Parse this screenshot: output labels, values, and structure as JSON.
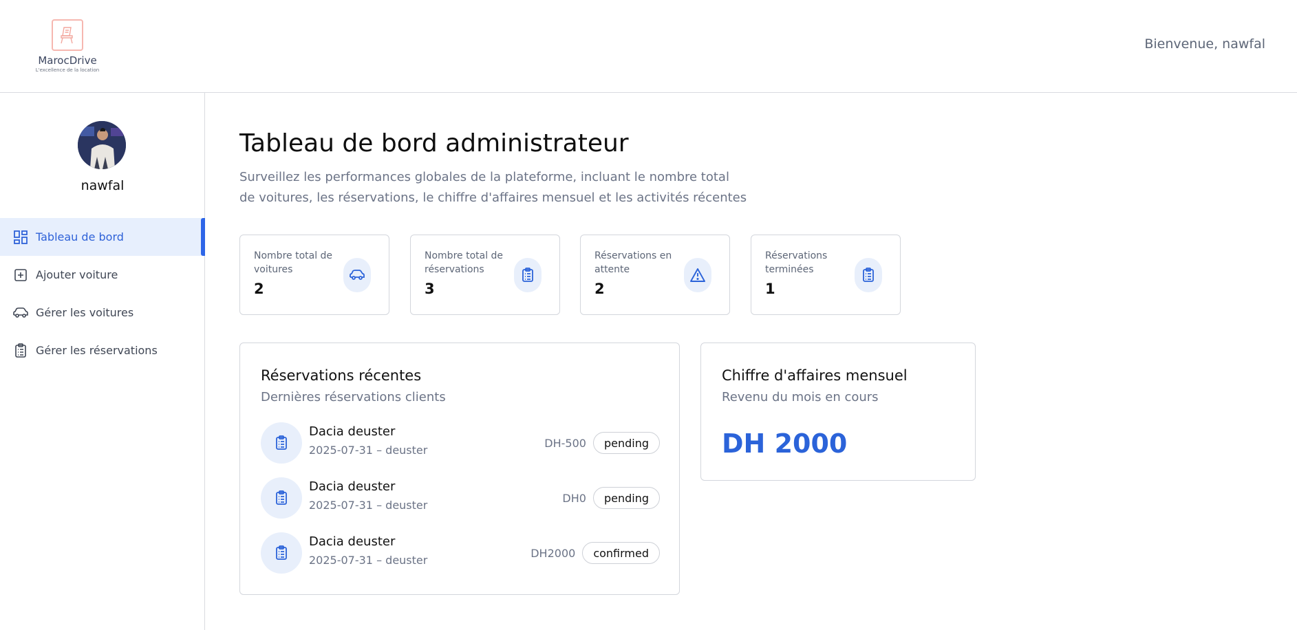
{
  "brand": {
    "name": "MarocDrive",
    "tagline": "L'excellence de la location"
  },
  "header": {
    "welcome": "Bienvenue, nawfal"
  },
  "sidebar": {
    "user_name": "nawfal",
    "items": [
      {
        "label": "Tableau de bord",
        "icon": "dashboard-icon",
        "active": true
      },
      {
        "label": "Ajouter voiture",
        "icon": "plus-square-icon",
        "active": false
      },
      {
        "label": "Gérer les voitures",
        "icon": "car-icon",
        "active": false
      },
      {
        "label": "Gérer les réservations",
        "icon": "clipboard-icon",
        "active": false
      }
    ]
  },
  "main": {
    "title": "Tableau de bord administrateur",
    "subtitle": "Surveillez les performances globales de la plateforme, incluant le nombre total de voitures, les réservations, le chiffre d'affaires mensuel et les activités récentes",
    "stats": [
      {
        "label": "Nombre total de voitures",
        "value": "2",
        "icon": "car-icon"
      },
      {
        "label": "Nombre total de réservations",
        "value": "3",
        "icon": "clipboard-icon"
      },
      {
        "label": "Réservations en attente",
        "value": "2",
        "icon": "warning-icon"
      },
      {
        "label": "Réservations terminées",
        "value": "1",
        "icon": "clipboard-icon"
      }
    ],
    "recent": {
      "title": "Réservations récentes",
      "subtitle": "Dernières réservations clients",
      "items": [
        {
          "title": "Dacia deuster",
          "meta": "2025-07-31 – deuster",
          "price": "DH-500",
          "status": "pending"
        },
        {
          "title": "Dacia deuster",
          "meta": "2025-07-31 – deuster",
          "price": "DH0",
          "status": "pending"
        },
        {
          "title": "Dacia deuster",
          "meta": "2025-07-31 – deuster",
          "price": "DH2000",
          "status": "confirmed"
        }
      ]
    },
    "revenue": {
      "title": "Chiffre d'affaires mensuel",
      "subtitle": "Revenu du mois en cours",
      "value": "DH 2000"
    }
  },
  "colors": {
    "accent": "#2e66e8",
    "active_bg": "#e7effd",
    "icon_bg": "#e8effb",
    "logo": "#f6b7b0"
  }
}
